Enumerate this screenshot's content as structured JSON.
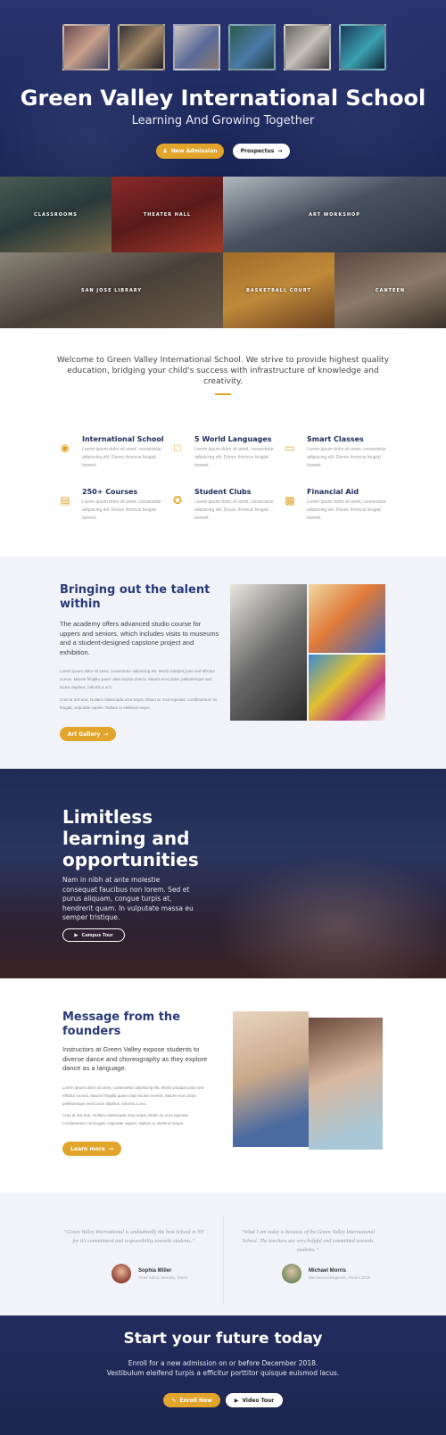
{
  "hero": {
    "title": "Green Valley International School",
    "subtitle": "Learning And Growing Together",
    "new_admission": "New Admission",
    "prospectus": "Prospectus"
  },
  "gallery": [
    "CLASSROOMS",
    "THEATER HALL",
    "ART WORKSHOP",
    "SAN JOSE LIBRARY",
    "BASKETBALL COURT",
    "CANTEEN"
  ],
  "welcome": "Welcome to Green Valley International School. We strive to provide highest quality education, bridging your child's success with infrastructure of knowledge and creativity.",
  "features": [
    {
      "title": "International School",
      "icon": "globe-icon",
      "text": "Lorem ipsum dolor sit amet, consectetur adipiscing elit. Donec rhoncus feugiat laoreet."
    },
    {
      "title": "5 World Languages",
      "icon": "language-icon",
      "text": "Lorem ipsum dolor sit amet, consectetur adipiscing elit. Donec rhoncus feugiat laoreet."
    },
    {
      "title": "Smart Classes",
      "icon": "laptop-icon",
      "text": "Lorem ipsum dolor sit amet, consectetur adipiscing elit. Donec rhoncus feugiat laoreet."
    },
    {
      "title": "250+ Courses",
      "icon": "book-icon",
      "text": "Lorem ipsum dolor sit amet, consectetur adipiscing elit. Donec rhoncus feugiat laoreet."
    },
    {
      "title": "Student Clubs",
      "icon": "star-badge-icon",
      "text": "Lorem ipsum dolor sit amet, consectetur adipiscing elit. Donec rhoncus feugiat laoreet."
    },
    {
      "title": "Financial Aid",
      "icon": "money-icon",
      "text": "Lorem ipsum dolor sit amet, consectetur adipiscing elit. Donec rhoncus feugiat laoreet."
    }
  ],
  "talent": {
    "title": "Bringing out the talent within",
    "lead": "The academy offers advanced studio course for uppers and seniors, which includes visits to museums and a student-designed capstone project and exhibition.",
    "p1": "Lorem ipsum dolor sit amet, consectetur adipiscing elit. Morbi volutpat justo sed efficitur cursus. Mauris fringilla quam vitae lacinia viverra. Mauris eros dolor, pellentesque sed luctus dapibus, lobortis a orci.",
    "p2": "Cras at nisl erat. Nullam malesuada urna turpis. Etiam ac eros egestas, condimentum mi feugiat, vulputate sapien. Nullam in eleifend neque.",
    "button": "Art Gallery"
  },
  "limitless": {
    "title": "Limitless learning and opportunities",
    "text": "Nam in nibh at ante molestie consequat faucibus non lorem. Sed et purus aliquam, congue turpis at, hendrerit quam. In vulputate massa eu semper tristique.",
    "button": "Campus Tour"
  },
  "founders": {
    "title": "Message from the founders",
    "lead": "Instructors at Green Valley expose students to diverse dance and choreography as they explore dance as a language.",
    "p1": "Lorem ipsum dolor sit amet, consectetur adipiscing elit. Morbi volutpat justo sed efficitur cursus. Mauris fringilla quam vitae lacinia viverra. Mauris eros dolor, pellentesque sed luctus dapibus, lobortis a orci.",
    "p2": "Cras at nisl erat. Nullam malesuada urna turpis. Etiam ac eros egestas, condimentum mi feugiat, vulputate sapien. Nullam in eleifend neque.",
    "button": "Learn more"
  },
  "testimonials": [
    {
      "quote": "“Green Valley International is undoubtedly the best School in NY for it’s commitment and responsibility towards students.”",
      "name": "Sophia Miller",
      "role": "Chief Editor, Monday Times"
    },
    {
      "quote": "“What I am today is because of the Green Valley International School. The teachers are very helpful and committed towards students.”",
      "name": "Michael Morris",
      "role": "Mechanical Engineer, Alumni 2015"
    }
  ],
  "cta": {
    "title": "Start your future today",
    "line1": "Enroll for a new admission on or before December 2018.",
    "line2": "Vestibulum eleifend turpis a efficitur porttitor quisque euismod lacus.",
    "enroll": "Enroll Now",
    "video": "Video Tour"
  },
  "colors": {
    "navy": "#1f2a5a",
    "gold": "#e2a52c",
    "light_bg": "#f1f3f8"
  }
}
